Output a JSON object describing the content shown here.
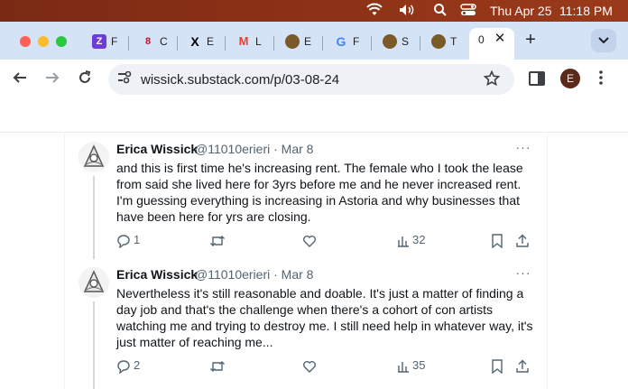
{
  "menubar": {
    "date": "Thu Apr 25",
    "time": "11:18 PM",
    "wifi_icon": "wifi-icon",
    "volume_icon": "volume-icon",
    "search_icon": "spotlight-search-icon",
    "control_center_icon": "control-center-icon"
  },
  "tabs": [
    {
      "label": "F",
      "favicon": "Z",
      "favicon_color": "#6c3bd8"
    },
    {
      "label": "C",
      "favicon": "8",
      "favicon_color": "#c8102e"
    },
    {
      "label": "E",
      "favicon": "X",
      "favicon_color": "#000000"
    },
    {
      "label": "L",
      "favicon": "M",
      "favicon_color": "#ea4335"
    },
    {
      "label": "E",
      "favicon": "",
      "favicon_color": "#7b5a2a"
    },
    {
      "label": "F",
      "favicon": "G",
      "favicon_color": "#4285f4"
    },
    {
      "label": "S",
      "favicon": "",
      "favicon_color": "#7b5a2a"
    },
    {
      "label": "T",
      "favicon": "",
      "favicon_color": "#7b5a2a"
    }
  ],
  "active_tab": {
    "label": "0",
    "close": "✕"
  },
  "new_tab": "+",
  "toolbar": {
    "url": "wissick.substack.com/p/03-08-24",
    "profile_initial": "E"
  },
  "tweets": [
    {
      "name": "Erica Wissick",
      "handle": "@11010erieri · Mar 8",
      "more": "···",
      "body": "and this is first time he's increasing rent. The female who I took the lease from said she lived here for 3yrs before me and he never increased rent. I'm guessing everything is increasing in Astoria and why businesses that have been here for yrs are closing.",
      "replies": "1",
      "retweets": "",
      "likes": "",
      "views": "32"
    },
    {
      "name": "Erica Wissick",
      "handle": "@11010erieri · Mar 8",
      "more": "···",
      "body": "Nevertheless it's still reasonable and doable. It's just a matter of finding a day job and that's the challenge when there's a cohort of con artists watching me and trying to destroy me. I still need help in whatever way, it's just matter of reaching me...",
      "replies": "2",
      "retweets": "",
      "likes": "",
      "views": "35"
    }
  ],
  "colors": {
    "tab_strip": "#d5e3f7",
    "menubar": "#8a3016",
    "text_primary": "#0f1419",
    "text_secondary": "#536471"
  }
}
